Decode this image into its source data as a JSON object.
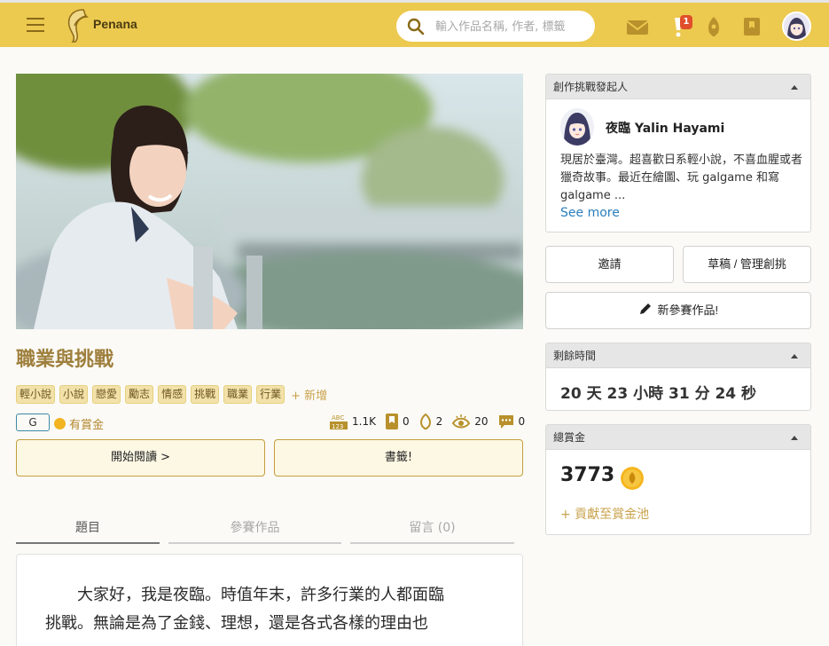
{
  "header": {
    "brand": "Penana",
    "search_placeholder": "輸入作品名稱, 作者, 標籤",
    "notification_count": "1"
  },
  "work": {
    "title": "職業與挑戰",
    "tags": [
      "輕小說",
      "小說",
      "戀愛",
      "勵志",
      "情感",
      "挑戰",
      "職業",
      "行業"
    ],
    "add_tag_label": "+ 新增",
    "rating": "G",
    "bounty_label": "有賞金",
    "stats": {
      "words": "1.1K",
      "bookmarks": "0",
      "likes": "2",
      "views": "20",
      "comments": "0"
    },
    "start_reading_label": "開始閱讀 >",
    "bookmark_label": "書籤!"
  },
  "tabs": {
    "topic": "題目",
    "entries": "參賽作品",
    "comments": "留言 (0)"
  },
  "content": {
    "line1": "大家好，我是夜臨。時值年末，許多行業的人都面臨",
    "line2": "挑戰。無論是為了金錢、理想，還是各式各樣的理由也"
  },
  "sidebar": {
    "organizer_heading": "創作挑戰發起人",
    "author_name": "夜臨 Yalin Hayami",
    "author_bio": "現居於臺灣。超喜歡日系輕小說，不喜血腥或者獵奇故事。最近在繪圖、玩 galgame 和寫 galgame ...",
    "see_more": "See more",
    "invite_label": "邀請",
    "manage_label": "草稿 / 管理創挑",
    "new_entry_label": "新參賽作品!",
    "time_heading": "剩餘時間",
    "time_value": "20 天 23 小時 31 分 24 秒",
    "prize_heading": "總賞金",
    "prize_amount": "3773",
    "contribute_label": "+ 貢獻至賞金池"
  },
  "colors": {
    "header_bg": "#ecc94f",
    "accent_gold": "#9e7f3c",
    "link_blue": "#2a7fbd"
  }
}
